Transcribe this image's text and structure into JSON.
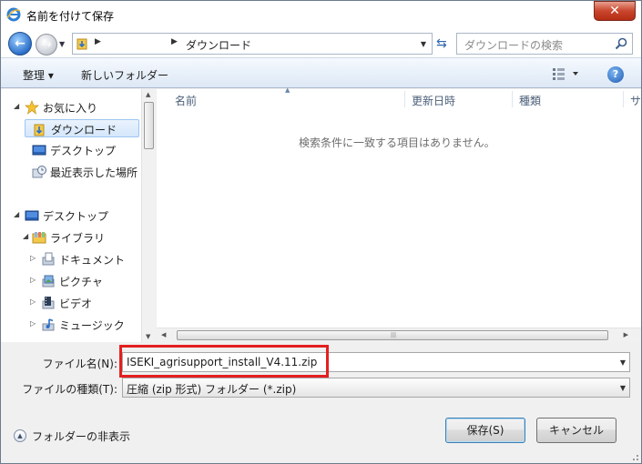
{
  "window": {
    "title": "名前を付けて保存",
    "close_label": "✕"
  },
  "address": {
    "current_folder": "ダウンロード",
    "search_placeholder": "ダウンロードの検索"
  },
  "toolbar": {
    "organize_label": "整理 ▾",
    "new_folder_label": "新しいフォルダー"
  },
  "nav_tree": {
    "items": [
      {
        "label": "お気に入り",
        "icon": "star-icon"
      },
      {
        "label": "ダウンロード",
        "icon": "download-folder-icon"
      },
      {
        "label": "デスクトップ",
        "icon": "desktop-icon"
      },
      {
        "label": "最近表示した場所",
        "icon": "recent-places-icon"
      },
      {
        "label": "デスクトップ",
        "icon": "desktop-icon"
      },
      {
        "label": "ライブラリ",
        "icon": "library-icon"
      },
      {
        "label": "ドキュメント",
        "icon": "documents-icon"
      },
      {
        "label": "ピクチャ",
        "icon": "pictures-icon"
      },
      {
        "label": "ビデオ",
        "icon": "videos-icon"
      },
      {
        "label": "ミュージック",
        "icon": "music-icon"
      }
    ]
  },
  "file_list": {
    "columns": [
      "名前",
      "更新日時",
      "種類",
      "サ"
    ],
    "empty_message": "検索条件に一致する項目はありません。"
  },
  "form": {
    "filename_label": "ファイル名(N):",
    "filename_value": "ISEKI_agrisupport_install_V4.11.zip",
    "filetype_label": "ファイルの種類(T):",
    "filetype_value": "圧縮 (zip 形式) フォルダー (*.zip)"
  },
  "footer": {
    "hide_folders_label": "フォルダーの非表示",
    "save_label": "保存(S)",
    "cancel_label": "キャンセル"
  },
  "colors": {
    "highlight_box": "#e41f1f",
    "selection": "#d4e7fb",
    "close_button": "#c9462c"
  }
}
